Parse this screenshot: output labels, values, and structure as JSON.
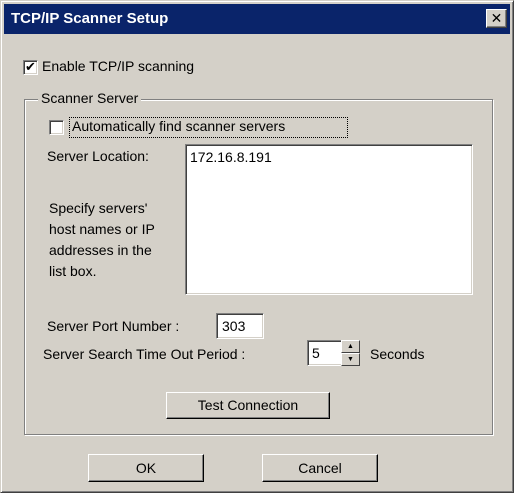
{
  "window": {
    "title": "TCP/IP Scanner Setup",
    "close_label": "✕"
  },
  "enable_tcpip": {
    "label": "Enable TCP/IP scanning",
    "checked": true
  },
  "scanner_server": {
    "group_title": "Scanner Server",
    "auto_find": {
      "label": "Automatically find scanner servers",
      "checked": false
    },
    "server_location_label": "Server Location:",
    "help_lines": [
      "Specify servers'",
      "host names or IP",
      "addresses in the",
      "list box."
    ],
    "server_list": [
      "172.16.8.191"
    ],
    "port_label": "Server Port Number :",
    "port_value": "303",
    "timeout_label": "Server Search Time Out Period :",
    "timeout_value": "5",
    "timeout_unit": "Seconds",
    "test_button": "Test Connection"
  },
  "buttons": {
    "ok": "OK",
    "cancel": "Cancel"
  },
  "icons": {
    "check": "check-mark",
    "close": "close-x",
    "up": "▲",
    "down": "▼"
  }
}
